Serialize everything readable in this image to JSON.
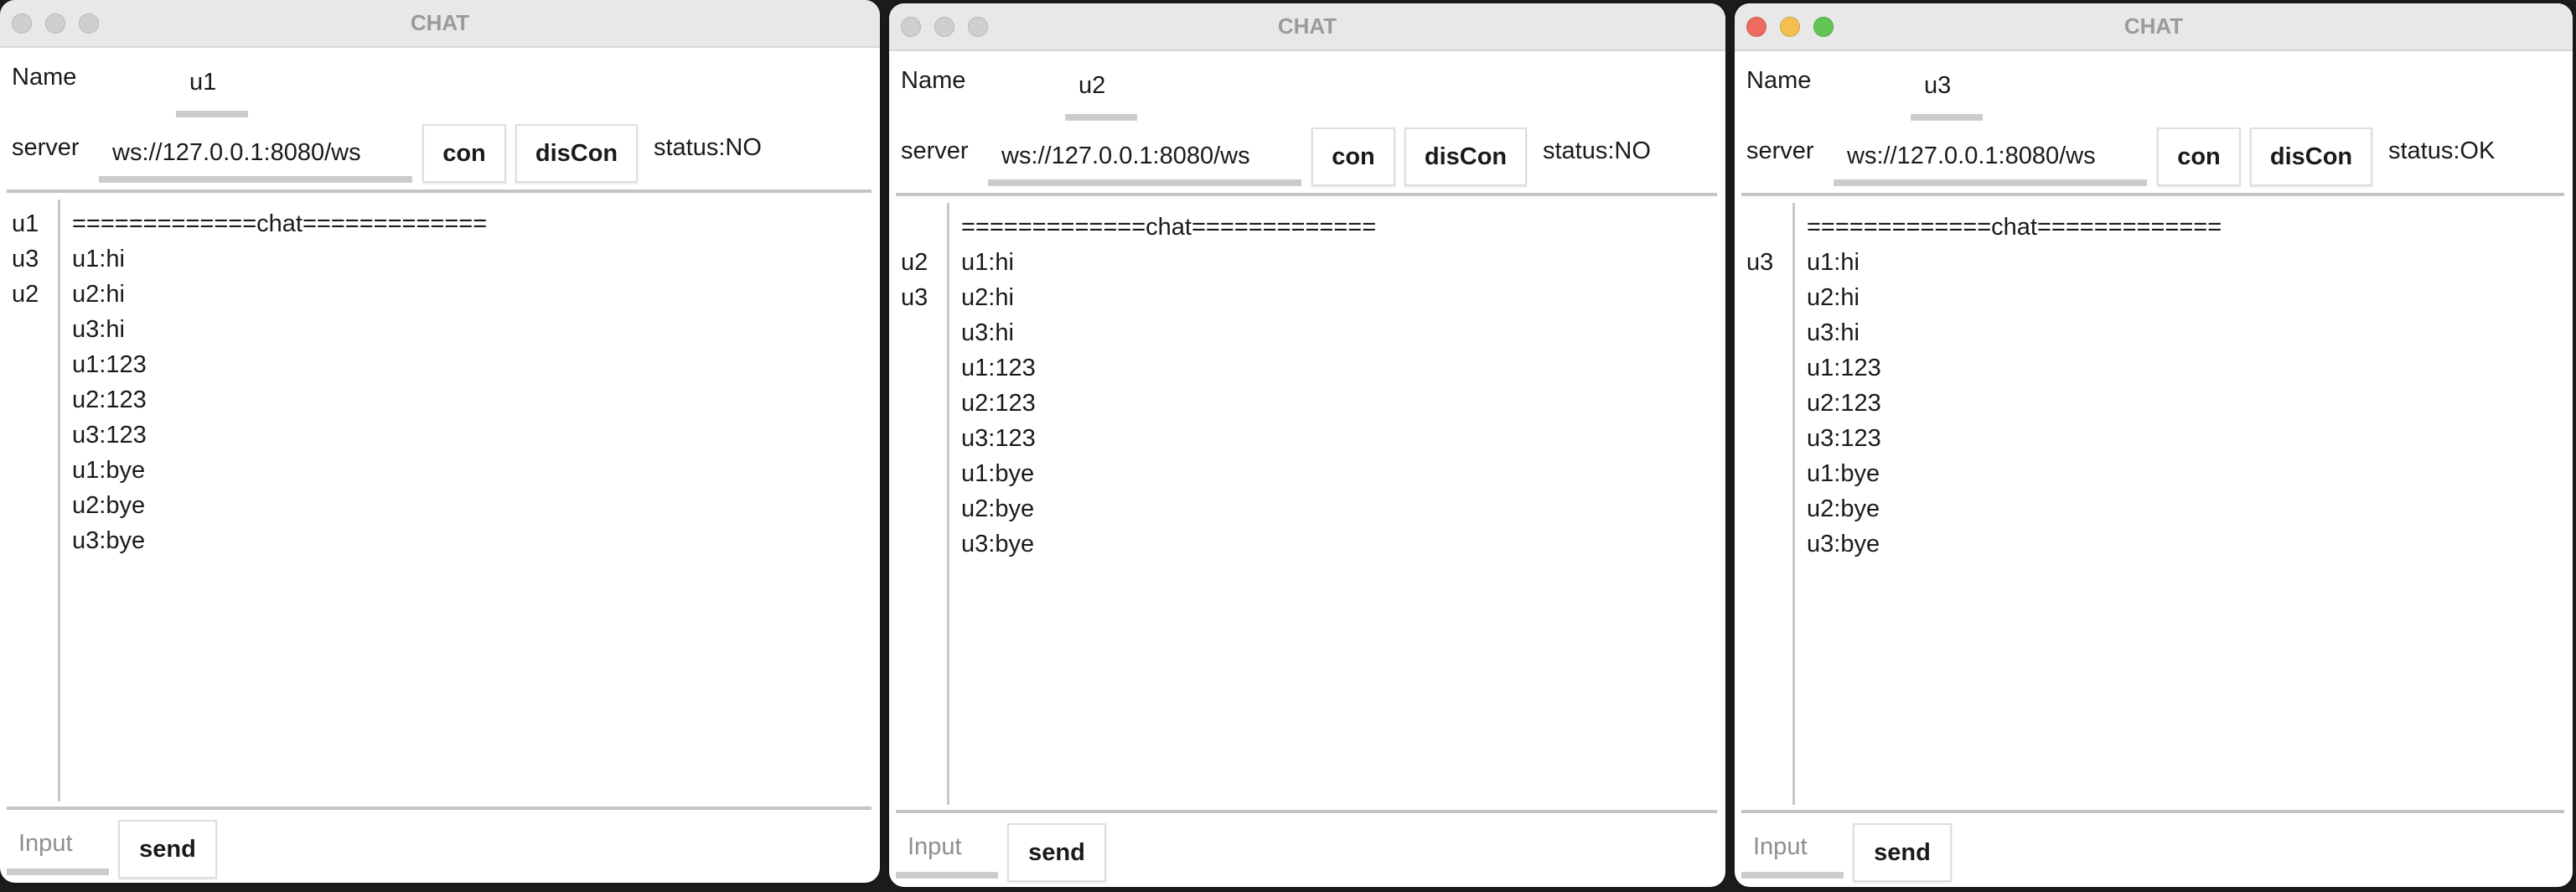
{
  "windows": [
    {
      "title": "CHAT",
      "active": false,
      "name_label": "Name",
      "name_value": "u1",
      "server_label": "server",
      "server_value": "ws://127.0.0.1:8080/ws",
      "con_label": "con",
      "discon_label": "disCon",
      "status": "status:NO",
      "users": [
        "u1",
        "u3",
        "u2"
      ],
      "messages": [
        "=============chat=============",
        "u1:hi",
        "u2:hi",
        "u3:hi",
        "u1:123",
        "u2:123",
        "u3:123",
        "u1:bye",
        "u2:bye",
        "u3:bye"
      ],
      "input_placeholder": "Input",
      "send_label": "send"
    },
    {
      "title": "CHAT",
      "active": false,
      "name_label": "Name",
      "name_value": "u2",
      "server_label": "server",
      "server_value": "ws://127.0.0.1:8080/ws",
      "con_label": "con",
      "discon_label": "disCon",
      "status": "status:NO",
      "users": [
        "",
        "u2",
        "u3"
      ],
      "messages": [
        "=============chat=============",
        "u1:hi",
        "u2:hi",
        "u3:hi",
        "u1:123",
        "u2:123",
        "u3:123",
        "u1:bye",
        "u2:bye",
        "u3:bye"
      ],
      "input_placeholder": "Input",
      "send_label": "send"
    },
    {
      "title": "CHAT",
      "active": true,
      "name_label": "Name",
      "name_value": "u3",
      "server_label": "server",
      "server_value": "ws://127.0.0.1:8080/ws",
      "con_label": "con",
      "discon_label": "disCon",
      "status": "status:OK",
      "users": [
        "",
        "u3"
      ],
      "messages": [
        "=============chat=============",
        "u1:hi",
        "u2:hi",
        "u3:hi",
        "u1:123",
        "u2:123",
        "u3:123",
        "u1:bye",
        "u2:bye",
        "u3:bye"
      ],
      "input_placeholder": "Input",
      "send_label": "send"
    }
  ],
  "colors": {
    "close": "#ed6a5e",
    "minimize": "#f5bf4f",
    "zoom": "#61c554",
    "inactive": "#cfcfcf"
  }
}
